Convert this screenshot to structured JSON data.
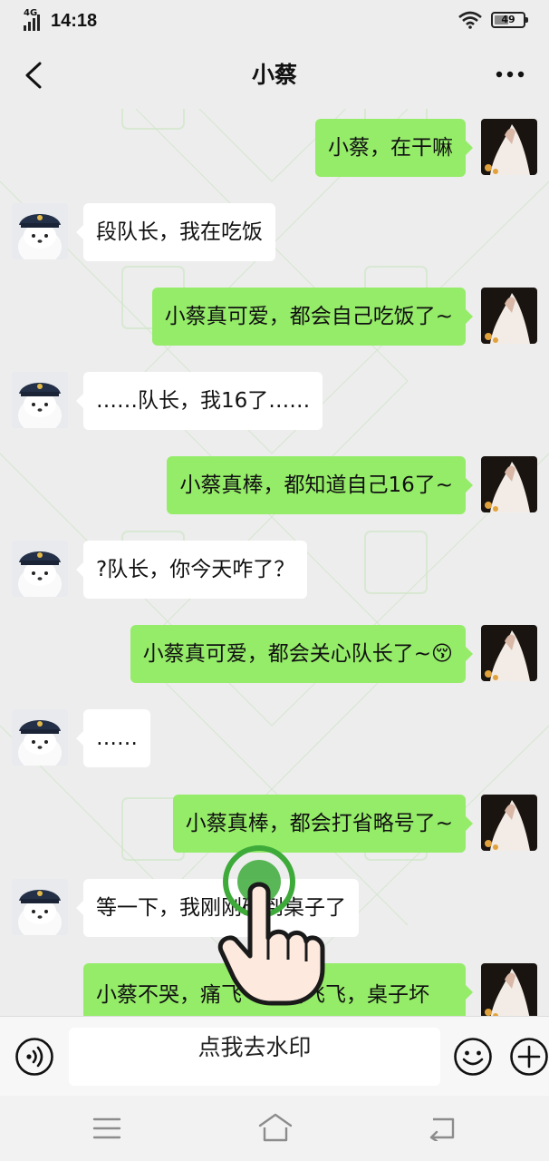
{
  "status_bar": {
    "network": "4G",
    "time": "14:18",
    "battery": "49"
  },
  "header": {
    "title": "小蔡"
  },
  "messages": [
    {
      "side": "out",
      "text": "小蔡，在干嘛"
    },
    {
      "side": "in",
      "text": "段队长，我在吃饭"
    },
    {
      "side": "out",
      "text": "小蔡真可爱，都会自己吃饭了~"
    },
    {
      "side": "in",
      "text": "……队长，我16了……"
    },
    {
      "side": "out",
      "text": "小蔡真棒，都知道自己16了~"
    },
    {
      "side": "in",
      "text": "?队长，你今天咋了？"
    },
    {
      "side": "out",
      "text": "小蔡真可爱，都会关心队长了~😚"
    },
    {
      "side": "in",
      "text": "……"
    },
    {
      "side": "out",
      "text": "小蔡真棒，都会打省略号了~"
    },
    {
      "side": "in",
      "text": "等一下，我刚刚磕到桌子了"
    },
    {
      "side": "out",
      "text": "小蔡不哭，痛飞飞，痛飞飞，桌子坏坏，咱们打桌子"
    }
  ],
  "input_bar": {
    "hint_text": "点我去水印"
  },
  "icons": {
    "back": "chevron-left-icon",
    "more": "more-dots-icon",
    "voice": "voice-icon",
    "emoji": "emoji-icon",
    "plus": "plus-icon"
  },
  "colors": {
    "outgoing_bubble": "#95ec69",
    "incoming_bubble": "#ffffff",
    "background": "#ededed"
  }
}
